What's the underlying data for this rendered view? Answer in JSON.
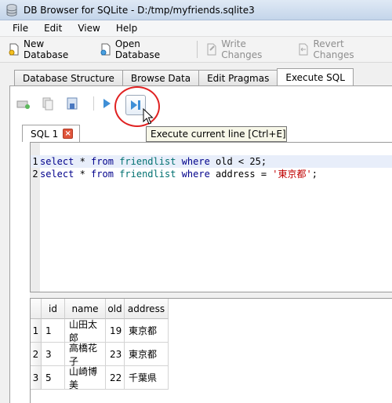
{
  "window": {
    "title": "DB Browser for SQLite - D:/tmp/myfriends.sqlite3"
  },
  "menu": {
    "items": [
      "File",
      "Edit",
      "View",
      "Help"
    ]
  },
  "toolbar": {
    "new_db": "New Database",
    "open_db": "Open Database",
    "write_changes": "Write Changes",
    "revert_changes": "Revert Changes"
  },
  "tabs": [
    "Database Structure",
    "Browse Data",
    "Edit Pragmas",
    "Execute SQL"
  ],
  "sql_tab": {
    "label": "SQL 1",
    "close": "×"
  },
  "tooltip": "Execute current line [Ctrl+E]",
  "editor": {
    "lines": [
      {
        "num": "1",
        "kw1": "select",
        "star": " * ",
        "kw2": "from",
        "sp1": " ",
        "table": "friendlist",
        "sp2": " ",
        "kw3": "where",
        "rest": " old < 25;",
        "str": "",
        "end": ""
      },
      {
        "num": "2",
        "kw1": "select",
        "star": " * ",
        "kw2": "from",
        "sp1": " ",
        "table": "friendlist",
        "sp2": " ",
        "kw3": "where",
        "rest": " address = ",
        "str": "'東京都'",
        "end": ";"
      }
    ]
  },
  "results": {
    "columns": [
      "id",
      "name",
      "old",
      "address"
    ],
    "rows": [
      {
        "num": "1",
        "cells": [
          "1",
          "山田太郎",
          "19",
          "東京都"
        ]
      },
      {
        "num": "2",
        "cells": [
          "3",
          "高橋花子",
          "23",
          "東京都"
        ]
      },
      {
        "num": "3",
        "cells": [
          "5",
          "山崎博美",
          "22",
          "千葉県"
        ]
      }
    ]
  },
  "colors": {
    "highlight_ring": "#e02222",
    "tooltip_bg": "#f7f7e8",
    "close_badge": "#e0553b"
  }
}
